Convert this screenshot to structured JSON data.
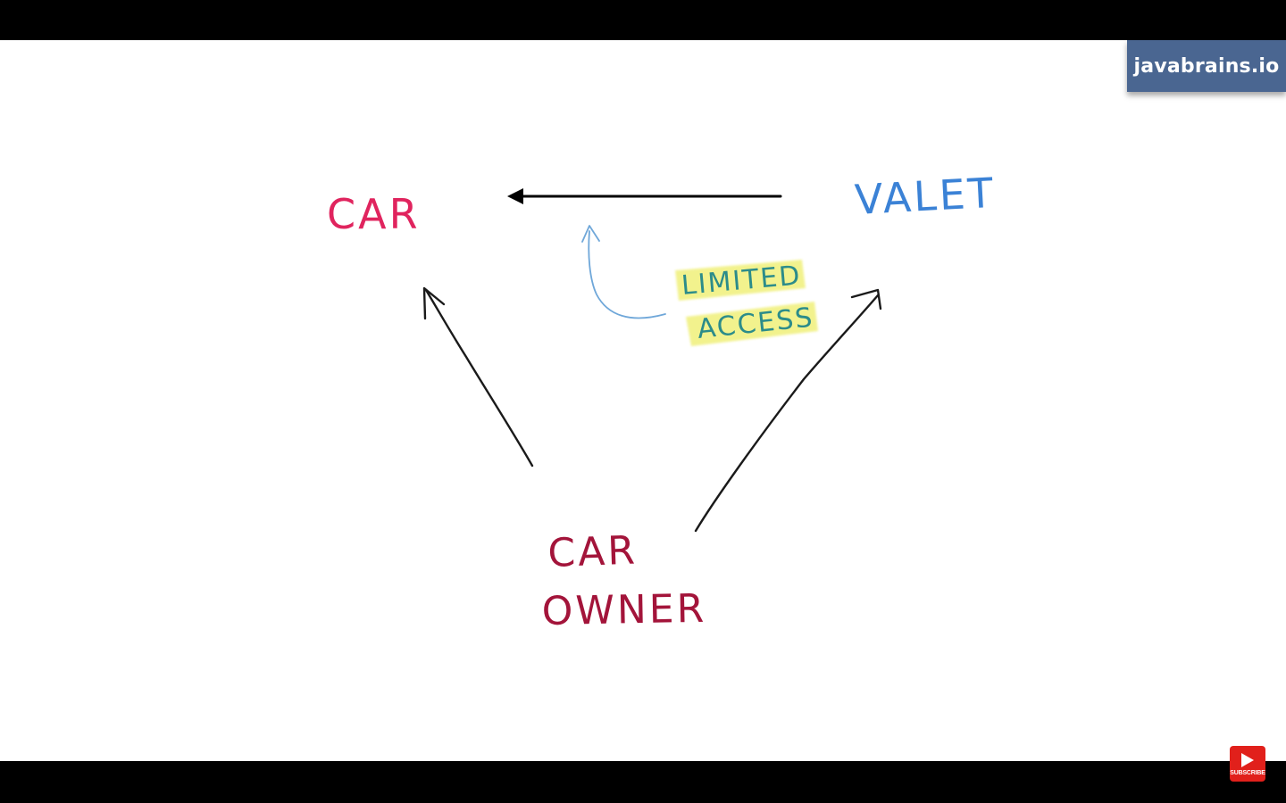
{
  "brand": {
    "label": "javabrains.io",
    "background": "#4a6691"
  },
  "diagram": {
    "nodes": {
      "car": {
        "label": "CAR",
        "color": "#e0245e"
      },
      "valet": {
        "label": "VALET",
        "color": "#3b82d6"
      },
      "car_owner": {
        "line1": "CAR",
        "line2": "OWNER",
        "color": "#a3143a"
      }
    },
    "annotation": {
      "line1": "LIMITED",
      "line2": "ACCESS",
      "text_color": "#2c8c8a",
      "highlight_color": "#f0f07a",
      "arrow_color": "#6fa7d9"
    },
    "edges": [
      {
        "from": "valet",
        "to": "car"
      },
      {
        "from": "car_owner",
        "to": "car"
      },
      {
        "from": "car_owner",
        "to": "valet"
      }
    ]
  },
  "subscribe": {
    "label": "SUBSCRIBE",
    "icon": "play-icon",
    "color": "#e1201b"
  }
}
